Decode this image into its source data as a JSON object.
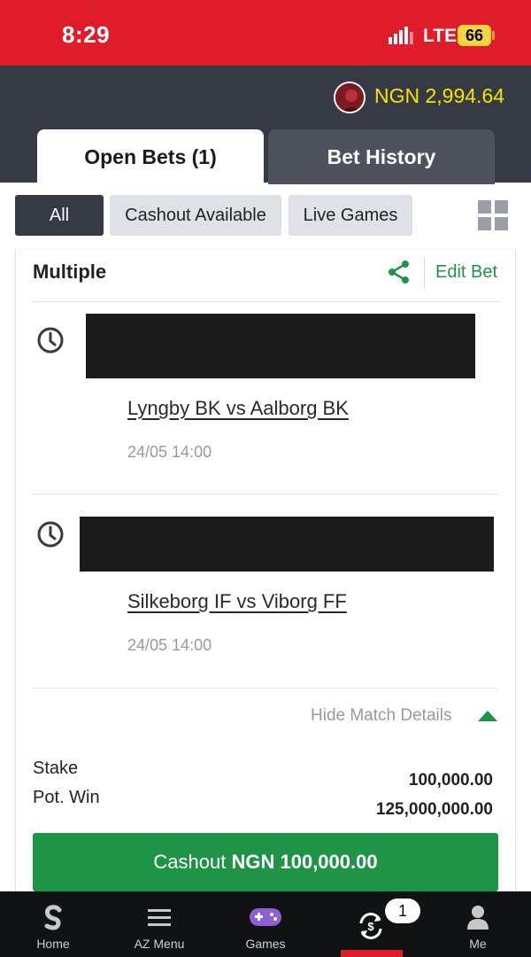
{
  "status_bar": {
    "time": "8:29",
    "network": "LTE",
    "battery": "66"
  },
  "header": {
    "balance": "NGN 2,994.64"
  },
  "tabs": [
    {
      "label": "Open Bets (1)",
      "active": true
    },
    {
      "label": "Bet History",
      "active": false
    }
  ],
  "filters": [
    {
      "label": "All",
      "active": true
    },
    {
      "label": "Cashout Available",
      "active": false
    },
    {
      "label": "Live Games",
      "active": false
    }
  ],
  "bet": {
    "type": "Multiple",
    "edit_label": "Edit Bet",
    "matches": [
      {
        "teams": "Lyngby BK vs Aalborg BK",
        "datetime": "24/05 14:00"
      },
      {
        "teams": "Silkeborg IF vs Viborg FF",
        "datetime": "24/05 14:00"
      }
    ],
    "hide_details_label": "Hide Match Details",
    "stake_label": "Stake",
    "potwin_label": "Pot. Win",
    "stake_value": "100,000.00",
    "potwin_value": "125,000,000.00",
    "cashout_prefix": "Cashout",
    "cashout_amount": "NGN 100,000.00"
  },
  "bottom_nav": [
    {
      "label": "Home",
      "icon": "sportybet-logo-icon"
    },
    {
      "label": "AZ Menu",
      "icon": "hamburger-menu-icon"
    },
    {
      "label": "Games",
      "icon": "gamepad-icon"
    },
    {
      "label": "",
      "icon": "bet-sync-icon",
      "badge": "1",
      "active": true
    },
    {
      "label": "Me",
      "icon": "user-icon"
    }
  ],
  "colors": {
    "status_red": "#e01b2a",
    "header_dark": "#363a45",
    "balance_yellow": "#f6e400",
    "accent_green": "#1f9447"
  }
}
